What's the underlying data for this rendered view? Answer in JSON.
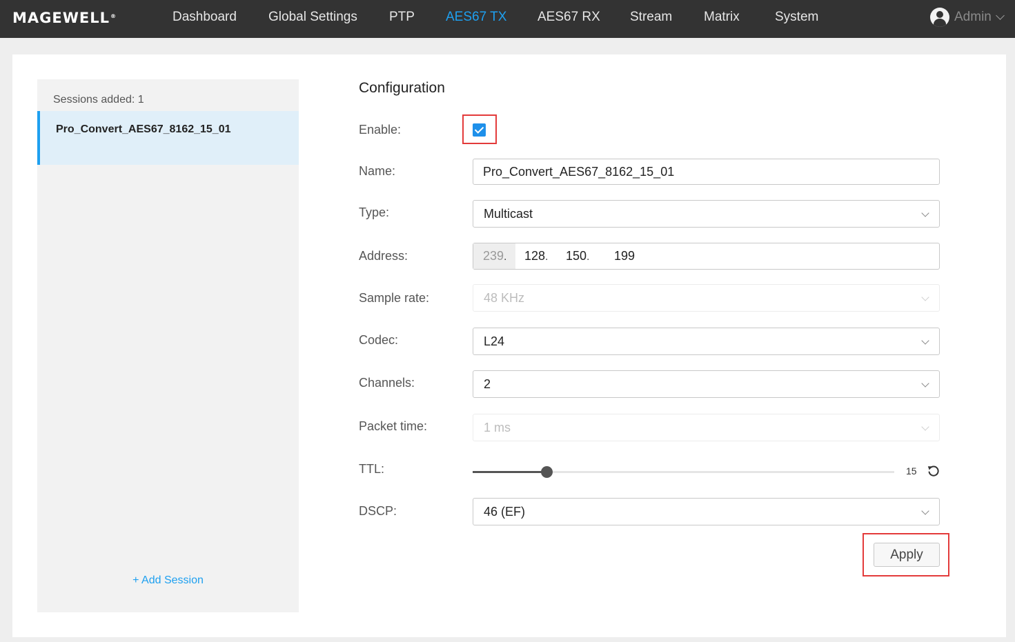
{
  "nav": {
    "logo": "MAGEWELL",
    "logo_mark": "®",
    "items": [
      "Dashboard",
      "Global Settings",
      "PTP",
      "AES67 TX",
      "AES67 RX",
      "Stream",
      "Matrix",
      "System"
    ],
    "active": "AES67 TX",
    "user": "Admin"
  },
  "sessions": {
    "count_label": "Sessions added: 1",
    "items": [
      "Pro_Convert_AES67_8162_15_01"
    ],
    "add_label": "+ Add Session"
  },
  "config": {
    "title": "Configuration",
    "enable": {
      "label": "Enable:",
      "checked": true
    },
    "name": {
      "label": "Name:",
      "value": "Pro_Convert_AES67_8162_15_01"
    },
    "type": {
      "label": "Type:",
      "value": "Multicast"
    },
    "address": {
      "label": "Address:",
      "octets": [
        "239",
        "128",
        "150",
        "199"
      ]
    },
    "sample_rate": {
      "label": "Sample rate:",
      "value": "48 KHz"
    },
    "codec": {
      "label": "Codec:",
      "value": "L24"
    },
    "channels": {
      "label": "Channels:",
      "value": "2"
    },
    "packet_time": {
      "label": "Packet time:",
      "value": "1 ms"
    },
    "ttl": {
      "label": "TTL:",
      "value": "15",
      "min": 0,
      "max": 255
    },
    "dscp": {
      "label": "DSCP:",
      "value": "46 (EF)"
    },
    "apply_label": "Apply"
  },
  "colors": {
    "accent": "#1ea0f0",
    "highlight": "#e33a3a",
    "topbar": "#333333"
  }
}
